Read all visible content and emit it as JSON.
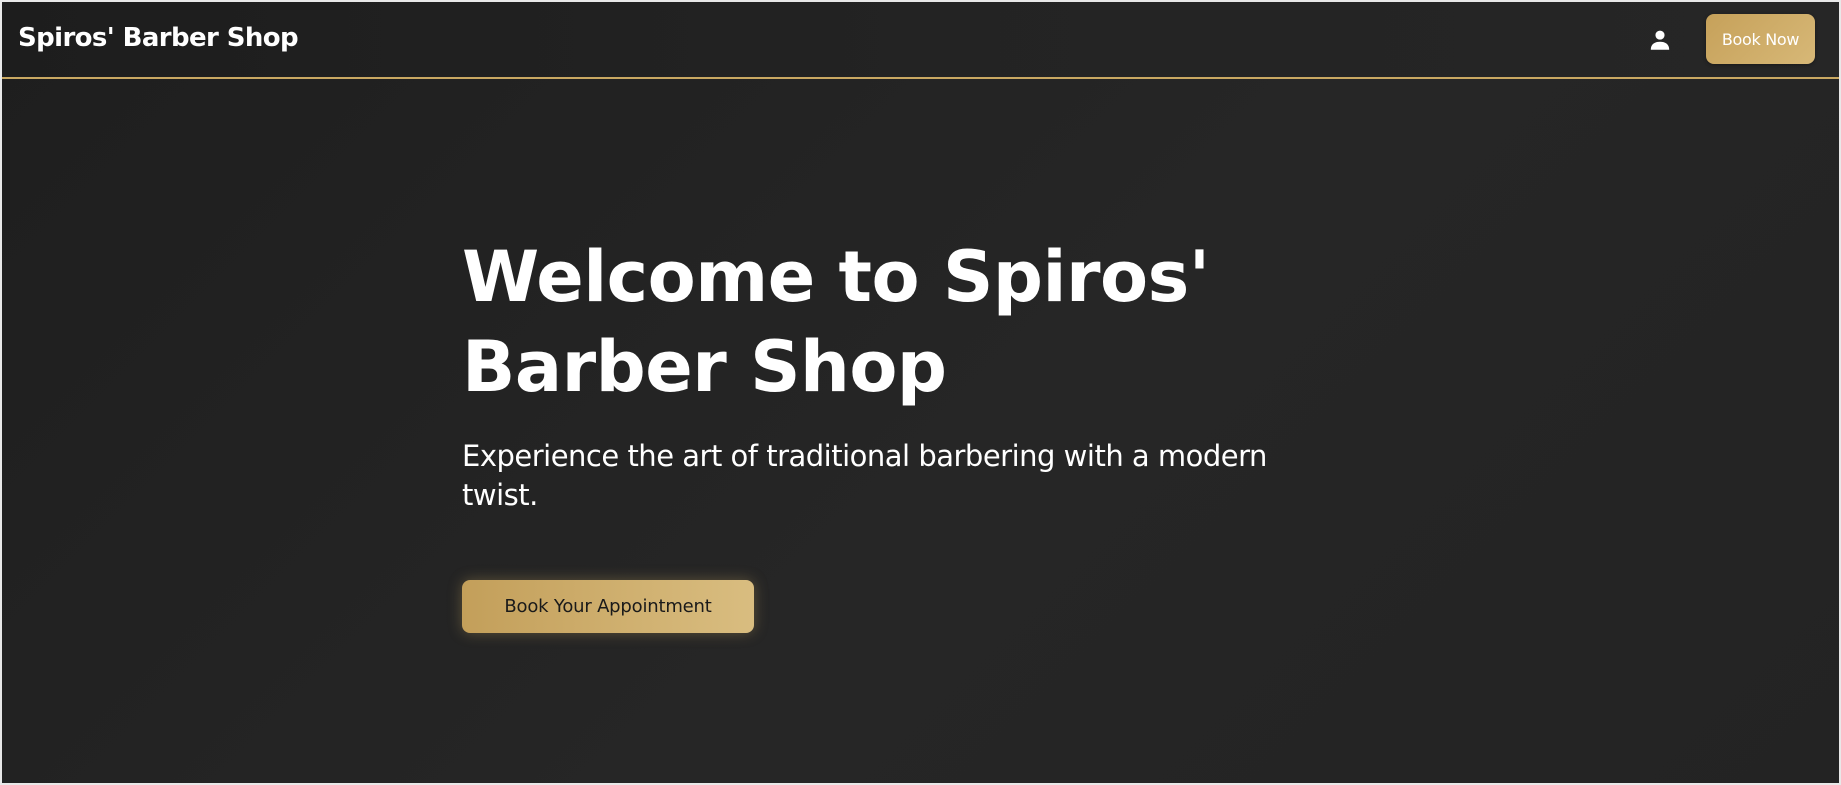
{
  "navbar": {
    "brand": "Spiros' Barber Shop",
    "user_icon": "user-icon",
    "book_now_label": "Book Now"
  },
  "hero": {
    "title_line1": "Welcome to Spiros'",
    "title_line2": "Barber Shop",
    "subtitle": "Experience the art of traditional barbering with a modern twist.",
    "cta_label": "Book Your Appointment"
  },
  "colors": {
    "accent_gold": "#c9a862",
    "background": "#222222",
    "text": "#ffffff"
  }
}
